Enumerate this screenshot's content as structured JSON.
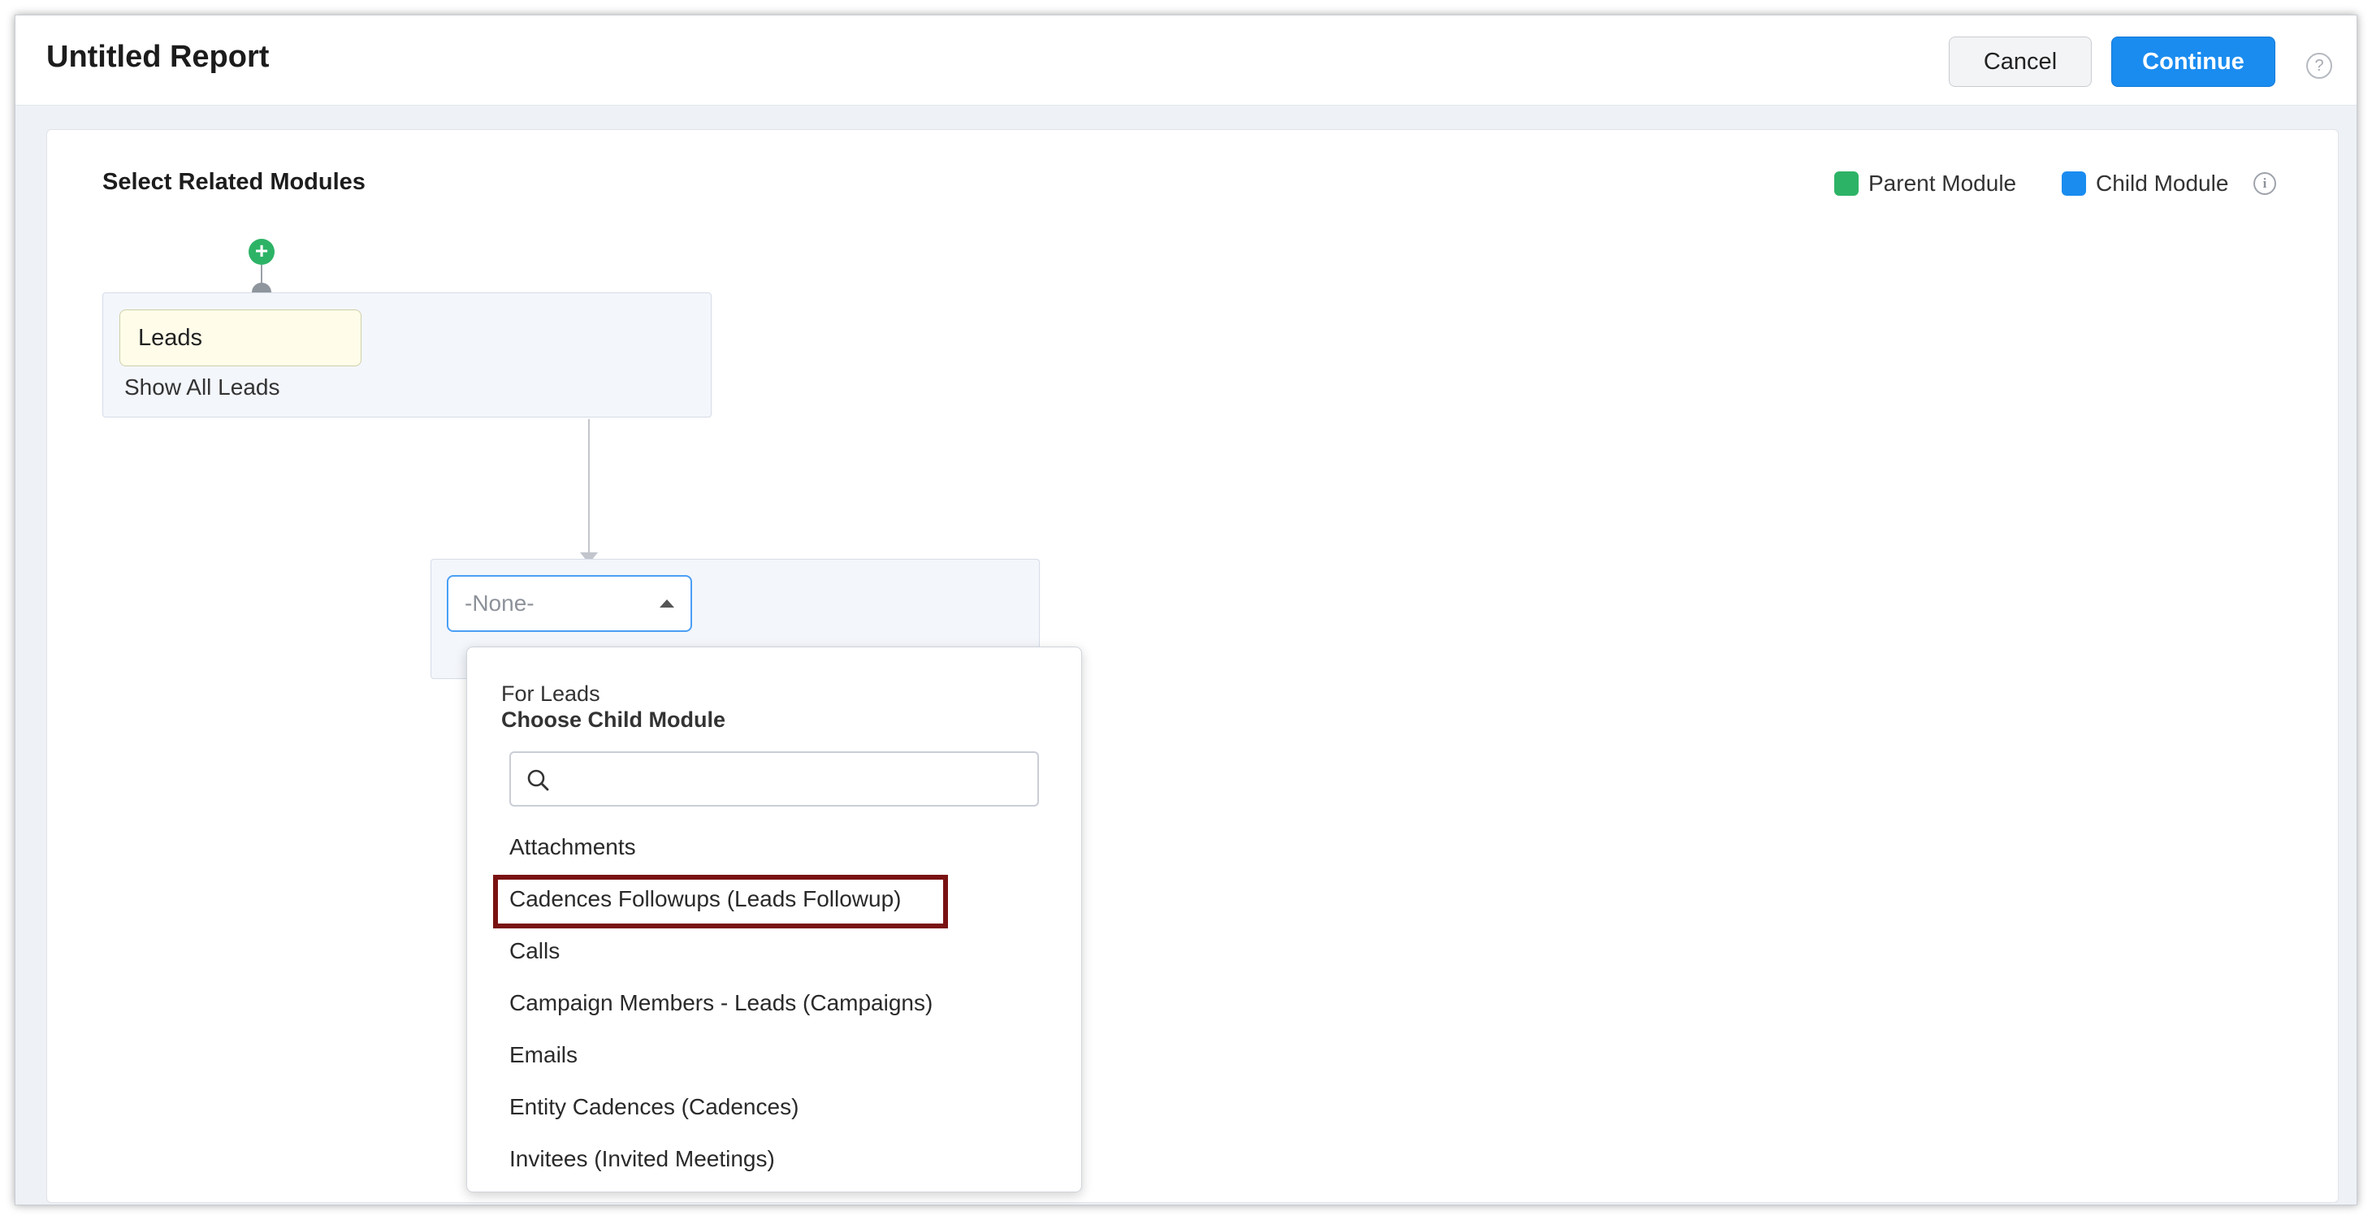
{
  "header": {
    "title": "Untitled Report",
    "cancel_label": "Cancel",
    "continue_label": "Continue",
    "help_glyph": "?"
  },
  "panel": {
    "section_title": "Select Related Modules",
    "legend": [
      {
        "label": "Parent Module",
        "color": "#2db366"
      },
      {
        "label": "Child Module",
        "color": "#1a8cf0"
      }
    ],
    "info_glyph": "i"
  },
  "parent_module": {
    "add_glyph": "+",
    "name": "Leads",
    "show_all_label": "Show All Leads"
  },
  "child_module": {
    "selected_value": "-None-"
  },
  "dropdown": {
    "context": "For Leads",
    "heading": "Choose Child Module",
    "search_placeholder": "",
    "items": [
      "Attachments",
      "Cadences Followups (Leads Followup)",
      "Calls",
      "Campaign Members - Leads (Campaigns)",
      "Emails",
      "Entity Cadences (Cadences)",
      "Invitees (Invited Meetings)"
    ],
    "highlighted_item": "Cadences Followups (Leads Followup)"
  },
  "icons": {
    "help": "question-circle-icon",
    "info": "info-circle-icon",
    "add": "plus-circle-icon",
    "search": "search-icon",
    "caret": "caret-up-icon"
  }
}
